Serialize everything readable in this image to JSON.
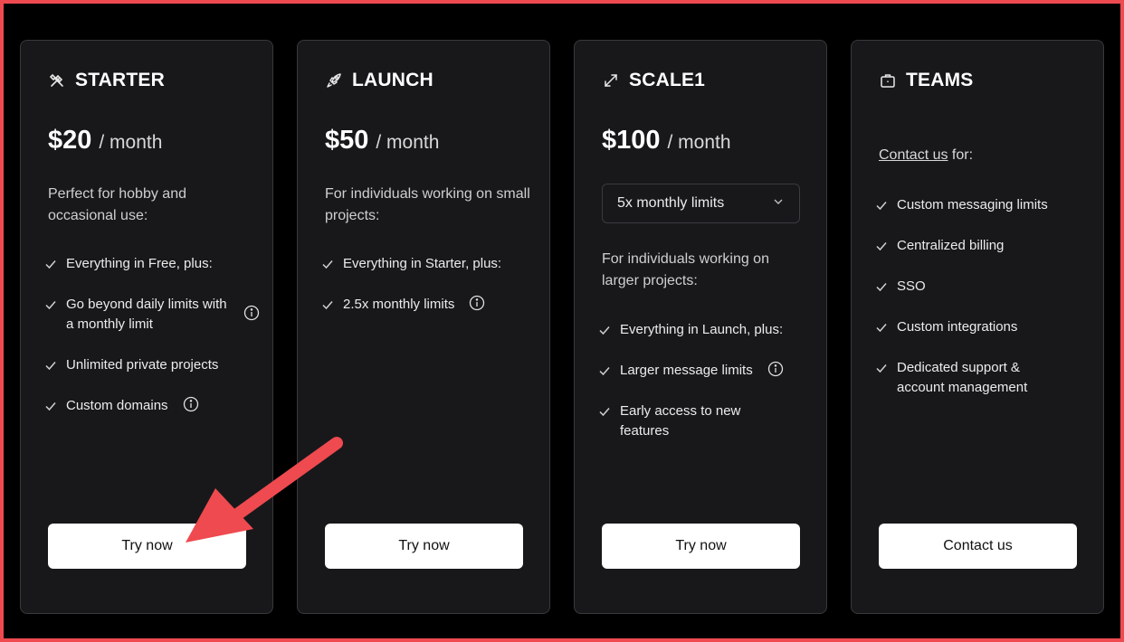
{
  "plans": [
    {
      "name": "STARTER",
      "icon": "tools-icon",
      "price": "$20",
      "period": "/ month",
      "description": "Perfect for hobby and occasional use:",
      "features": [
        {
          "text": "Everything in Free, plus:",
          "info": false
        },
        {
          "text": "Go beyond daily limits with a monthly limit",
          "info": true
        },
        {
          "text": "Unlimited private projects",
          "info": false
        },
        {
          "text": "Custom domains",
          "info": true
        }
      ],
      "cta": "Try now"
    },
    {
      "name": "LAUNCH",
      "icon": "rocket-icon",
      "price": "$50",
      "period": "/ month",
      "description": "For individuals working on small projects:",
      "features": [
        {
          "text": "Everything in Starter, plus:",
          "info": false
        },
        {
          "text": "2.5x monthly limits",
          "info": true
        }
      ],
      "cta": "Try now"
    },
    {
      "name": "SCALE1",
      "icon": "expand-arrows-icon",
      "price": "$100",
      "period": "/ month",
      "select_value": "5x monthly limits",
      "description": "For individuals working on larger projects:",
      "features": [
        {
          "text": "Everything in Launch, plus:",
          "info": false
        },
        {
          "text": "Larger message limits",
          "info": true
        },
        {
          "text": "Early access to new features",
          "info": false
        }
      ],
      "cta": "Try now"
    },
    {
      "name": "TEAMS",
      "icon": "briefcase-icon",
      "contact_link": "Contact us",
      "contact_suffix": " for:",
      "features": [
        {
          "text": "Custom messaging limits",
          "info": false
        },
        {
          "text": "Centralized billing",
          "info": false
        },
        {
          "text": "SSO",
          "info": false
        },
        {
          "text": "Custom integrations",
          "info": false
        },
        {
          "text": "Dedicated support & account management",
          "info": false
        }
      ],
      "cta": "Contact us"
    }
  ],
  "colors": {
    "background": "#000000",
    "card": "#18181b",
    "card_border": "#38383d",
    "annotation_red": "#ee4a4f",
    "button_bg": "#ffffff"
  }
}
